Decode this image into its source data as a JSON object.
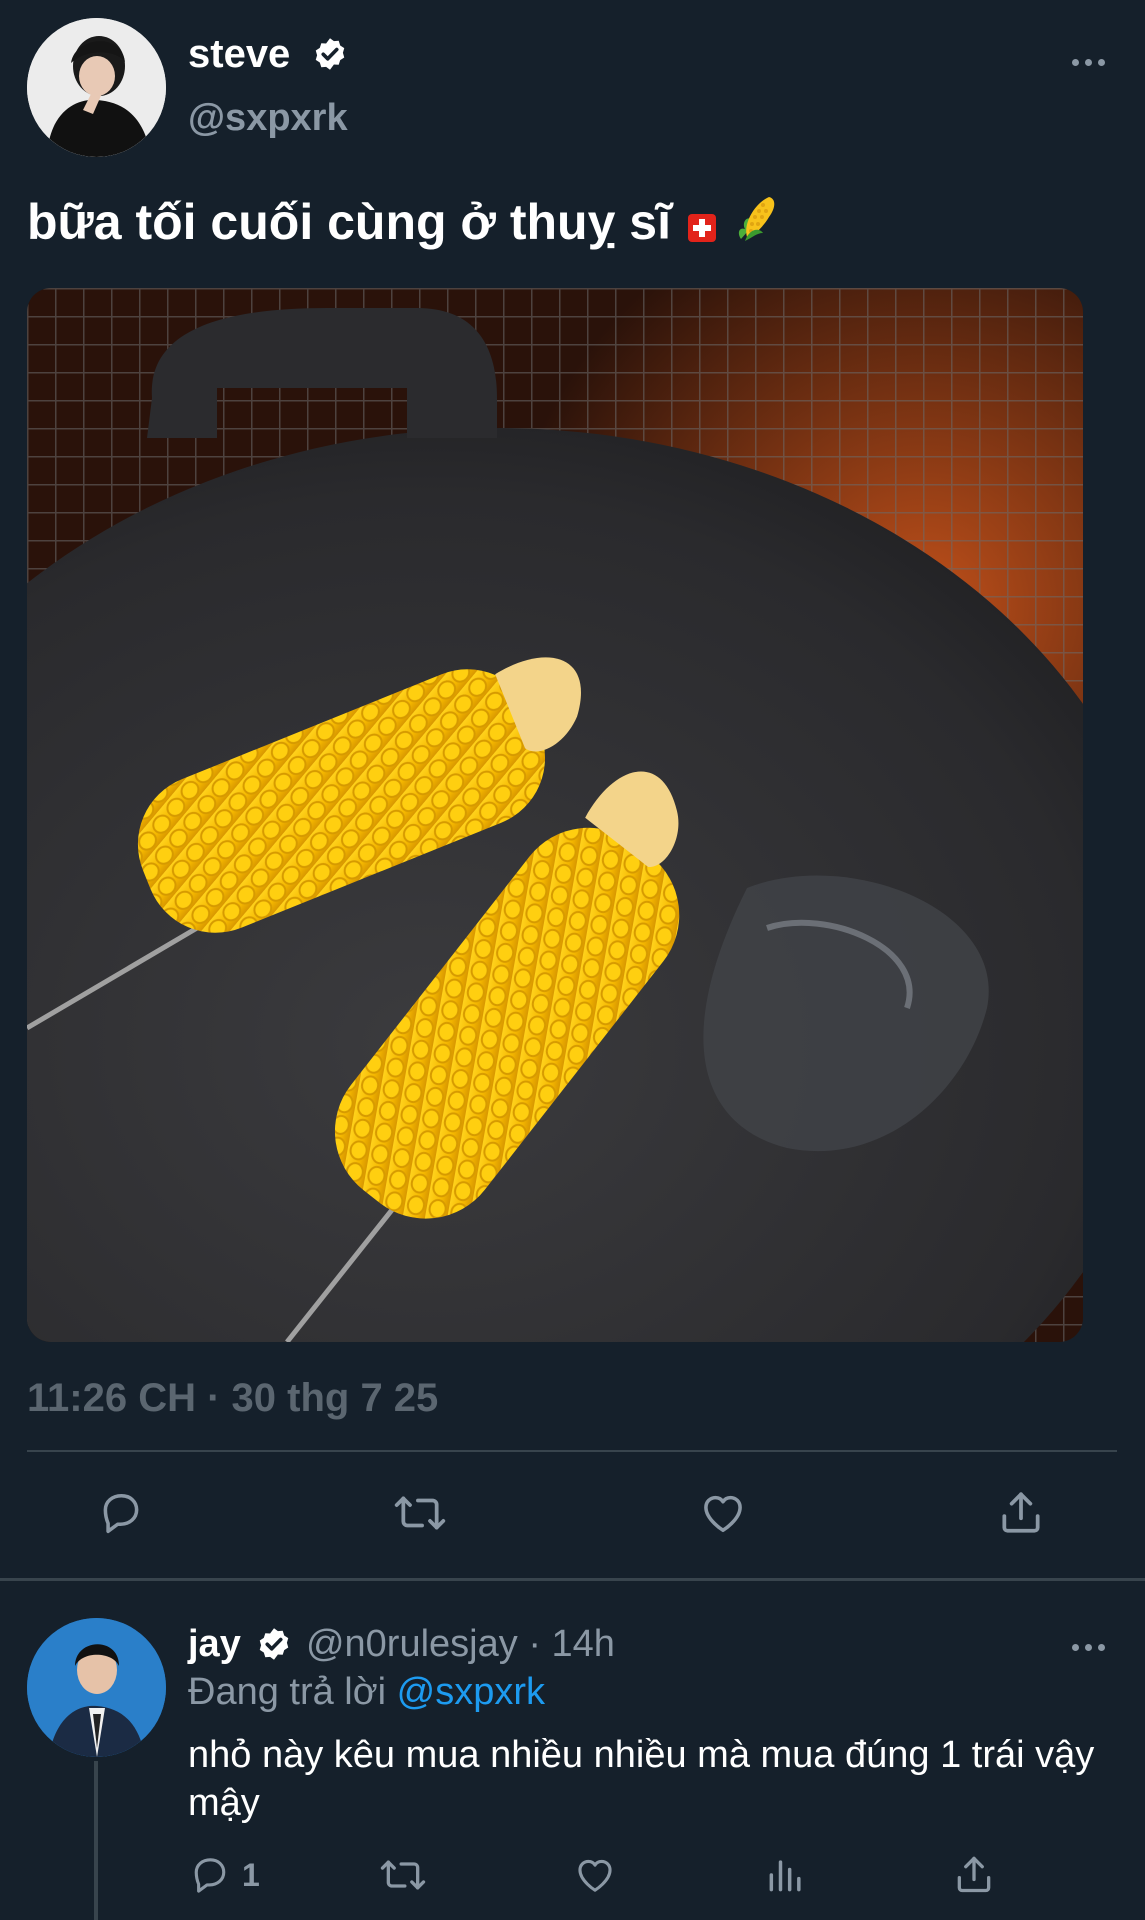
{
  "tweet": {
    "author_name": "steve",
    "author_handle": "@sxpxrk",
    "text": "bữa tối cuối cùng ở thuỵ sĩ",
    "emojis": [
      "swiss-flag",
      "corn"
    ],
    "timestamp": "11:26 CH · 30 thg 7 25",
    "image_alt": "two corn cobs on skewers on a black grill pan",
    "actions": [
      "reply-icon",
      "retweet-icon",
      "like-icon",
      "share-icon"
    ]
  },
  "reply": {
    "author_name": "jay",
    "author_handle": "@n0rulesjay",
    "time": "· 14h",
    "replying_prefix": "Đang trả lời",
    "replying_mention": "@sxpxrk",
    "text": "nhỏ này kêu mua nhiều nhiều mà mua đúng 1 trái vậy mậy",
    "reply_count": "1",
    "actions": [
      "reply-icon",
      "retweet-icon",
      "like-icon",
      "views-icon",
      "share-icon"
    ]
  },
  "colors": {
    "background": "#15202b",
    "text_primary": "#ffffff",
    "text_secondary": "#8b98a5",
    "timestamp": "#5b6670",
    "divider": "#38444d",
    "link": "#1d9bf0",
    "verified_badge": "#ffffff"
  }
}
